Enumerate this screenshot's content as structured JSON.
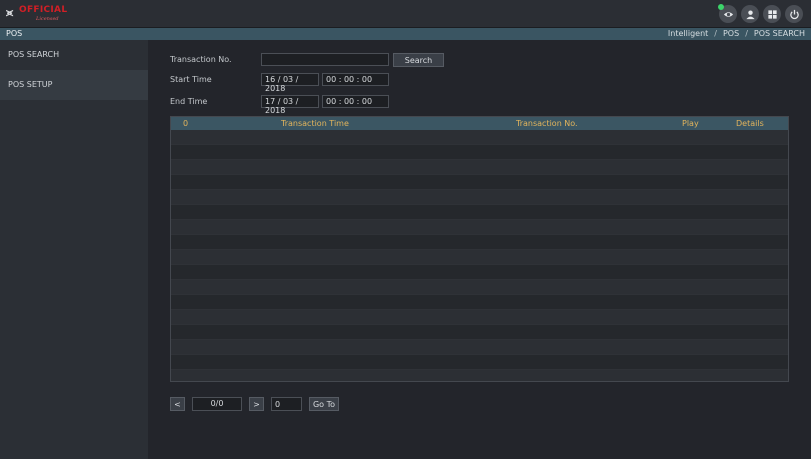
{
  "brand": {
    "logo_mark": "⪤",
    "logo_text": "OFFICIAL",
    "logo_sub": "Licensed"
  },
  "header": {
    "icons": [
      "eye-icon",
      "user-icon",
      "grid-icon",
      "power-icon"
    ],
    "online_color": "#3cd46a"
  },
  "titlebar": {
    "title": "POS",
    "breadcrumbs": [
      "Intelligent",
      "POS",
      "POS SEARCH"
    ],
    "separator": "/"
  },
  "sidebar": {
    "items": [
      {
        "label": "POS SEARCH"
      },
      {
        "label": "POS SETUP"
      }
    ]
  },
  "form": {
    "transaction_label": "Transaction No.",
    "transaction_value": "",
    "search_label": "Search",
    "start_label": "Start Time",
    "start_date": "16 / 03 / 2018",
    "start_time": "00 : 00 : 00",
    "end_label": "End Time",
    "end_date": "17 / 03 / 2018",
    "end_time": "00 : 00 : 00"
  },
  "table": {
    "count": "0",
    "columns": [
      "Transaction Time",
      "Transaction No.",
      "Play",
      "Details"
    ],
    "rows": []
  },
  "pager": {
    "prev": "<",
    "page": "0/0",
    "next": ">",
    "goto_value": "0",
    "goto_label": "Go To"
  },
  "colors": {
    "accent": "#3b5663",
    "header_text": "#e3b45c",
    "brand_red": "#d21f26"
  }
}
